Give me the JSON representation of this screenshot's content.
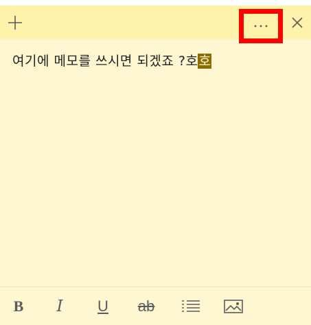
{
  "note": {
    "text_main": "여기에 메모를 쓰시면 되겠죠 ?호",
    "text_cursor": "호"
  },
  "titlebar": {
    "icons": [
      "plus-icon",
      "more-icon",
      "close-icon"
    ]
  },
  "toolbar": {
    "bold_label": "B",
    "italic_label": "I",
    "underline_label": "U",
    "strike_label": "ab",
    "icons": [
      "bulleted-list-icon",
      "image-icon"
    ]
  },
  "colors": {
    "note_background": "#fff7d1",
    "titlebar_background": "#fff2ab",
    "highlight_box": "#ff0000",
    "cursor_highlight": "#8a6d00"
  }
}
